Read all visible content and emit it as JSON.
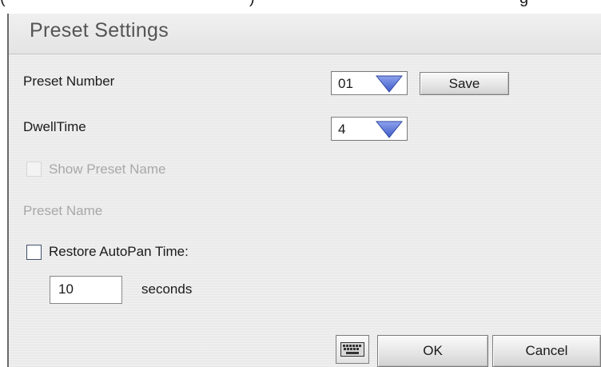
{
  "doc_fragment": {
    "open_paren": "(",
    "link_text": "",
    "close_paren": ")",
    "tail_text": "g"
  },
  "dialog": {
    "title": "Preset Settings",
    "preset_number": {
      "label": "Preset Number",
      "selected": "01",
      "save_label": "Save"
    },
    "dwell_time": {
      "label": "DwellTime",
      "selected": "4"
    },
    "show_preset_name": {
      "label": "Show Preset Name",
      "checked": false,
      "enabled": false
    },
    "preset_name": {
      "label": "Preset Name",
      "enabled": false
    },
    "restore_autopan": {
      "label": "Restore AutoPan Time:",
      "checked": false,
      "value": "10",
      "unit": "seconds"
    },
    "footer": {
      "keyboard_icon": "keyboard-icon",
      "ok_label": "OK",
      "cancel_label": "Cancel"
    }
  },
  "colors": {
    "dropdown_arrow": "#5a73d8",
    "link": "#1f3fd0",
    "disabled_text": "#a8a8a8"
  }
}
